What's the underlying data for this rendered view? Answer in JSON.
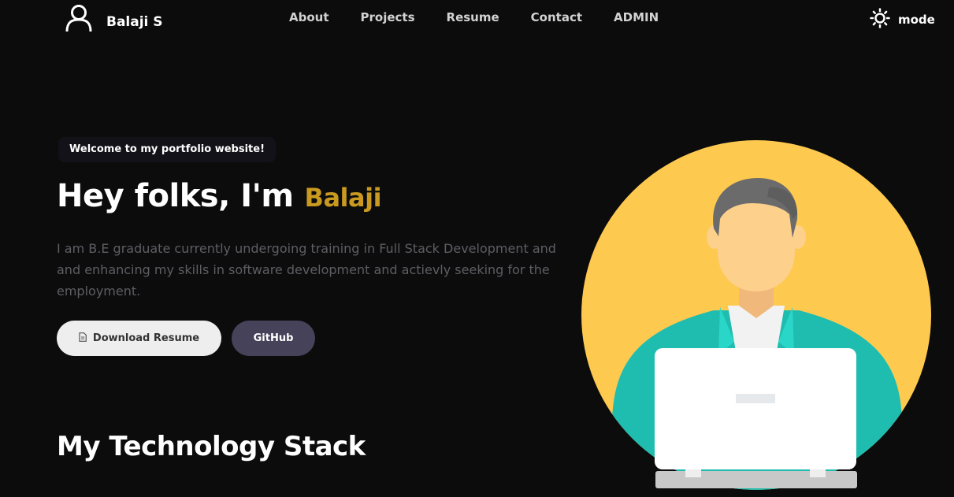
{
  "header": {
    "brand_name": "Balaji S",
    "nav": [
      "About",
      "Projects",
      "Resume",
      "Contact",
      "ADMIN"
    ],
    "mode_label": "mode"
  },
  "hero": {
    "badge": "Welcome to my portfolio website!",
    "headline_prefix": "Hey folks, I'm",
    "headline_name": "Balaji",
    "intro": "I am B.E graduate currently undergoing training in Full Stack Development and and enhancing my skills in software development and actievly seeking for the employment.",
    "resume_button": "Download Resume",
    "github_button": "GitHub"
  },
  "section": {
    "title": "My Technology Stack"
  },
  "icons": {
    "user": "user-icon",
    "mode": "sun-icon",
    "resume": "document-icon"
  },
  "colors": {
    "background": "#0c0c0d",
    "accent": "#c99a1f",
    "illustration_circle": "#fec94f",
    "github_button": "#454259"
  }
}
